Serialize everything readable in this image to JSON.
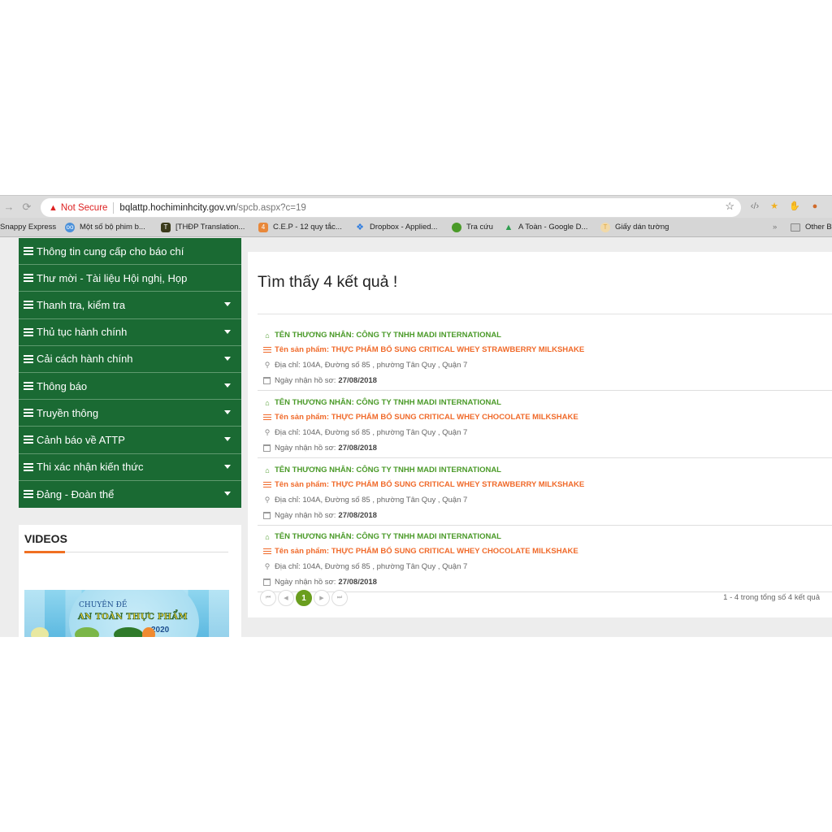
{
  "browser": {
    "nav": {
      "forward_icon": "→",
      "reload_icon": "⟳"
    },
    "security_label": "Not Secure",
    "url_host": "bqlattp.hochiminhcity.gov.vn",
    "url_path": "/spcb.aspx?c=19",
    "bookmarks": [
      {
        "label": "Snappy Express",
        "icon": "none"
      },
      {
        "label": "Một số bộ phim b...",
        "icon": "owl-icon",
        "color": "#4a90d9"
      },
      {
        "label": "[THĐP Translation...",
        "icon": "t-logo-icon",
        "color": "#3a3a1a"
      },
      {
        "label": "C.E.P - 12 quy tắc...",
        "icon": "c-logo-icon",
        "color": "#e8883a"
      },
      {
        "label": "Dropbox - Applied...",
        "icon": "dropbox-icon",
        "color": "#2f7de0"
      },
      {
        "label": "Tra cứu",
        "icon": "green-badge-icon",
        "color": "#4a9a28"
      },
      {
        "label": "A Toàn - Google D...",
        "icon": "google-drive-icon",
        "color": "#2e9d4f"
      },
      {
        "label": "Giấy dán tường",
        "icon": "t-circle-icon",
        "color": "#e0a840"
      }
    ],
    "more_bookmarks": "»",
    "other_bookmarks": "Other B"
  },
  "sidebar": {
    "menu": [
      {
        "label": "Thông tin cung cấp cho báo chí",
        "has_submenu": false
      },
      {
        "label": "Thư mời - Tài liệu Hội nghị, Họp",
        "has_submenu": false
      },
      {
        "label": "Thanh tra, kiểm tra",
        "has_submenu": true
      },
      {
        "label": "Thủ tục hành chính",
        "has_submenu": true
      },
      {
        "label": "Cải cách hành chính",
        "has_submenu": true
      },
      {
        "label": "Thông báo",
        "has_submenu": true
      },
      {
        "label": "Truyền thông",
        "has_submenu": true
      },
      {
        "label": "Cảnh báo về ATTP",
        "has_submenu": true
      },
      {
        "label": "Thi xác nhận kiến thức",
        "has_submenu": true
      },
      {
        "label": "Đảng - Đoàn thể",
        "has_submenu": true
      }
    ],
    "videos": {
      "title": "VIDEOS",
      "thumbnail": {
        "subtitle": "CHUYÊN ĐỀ",
        "title": "AN TOÀN THỰC PHẨM",
        "year": "2020"
      }
    }
  },
  "results": {
    "heading": "Tìm thấy 4 kết quả !",
    "items": [
      {
        "merchant": "TÊN THƯƠNG NHÂN: CÔNG TY TNHH MADI INTERNATIONAL",
        "product_label": "Tên sản phẩm:",
        "product": "THỰC PHẨM BỔ SUNG CRITICAL WHEY STRAWBERRY MILKSHAKE",
        "address": "Địa chỉ: 104A, Đường số 85 , phường Tân Quy , Quận 7",
        "date_label": "Ngày nhận hồ sơ:",
        "date": "27/08/2018"
      },
      {
        "merchant": "TÊN THƯƠNG NHÂN: CÔNG TY TNHH MADI INTERNATIONAL",
        "product_label": "Tên sản phẩm:",
        "product": "THỰC PHẨM BỔ SUNG CRITICAL WHEY CHOCOLATE MILKSHAKE",
        "address": "Địa chỉ: 104A, Đường số 85 , phường Tân Quy , Quận 7",
        "date_label": "Ngày nhận hồ sơ:",
        "date": "27/08/2018"
      },
      {
        "merchant": "TÊN THƯƠNG NHÂN: CÔNG TY TNHH MADI INTERNATIONAL",
        "product_label": "Tên sản phẩm:",
        "product": "THỰC PHẨM BỔ SUNG CRITICAL WHEY STRAWBERRY MILKSHAKE",
        "address": "Địa chỉ: 104A, Đường số 85 , phường Tân Quy , Quận 7",
        "date_label": "Ngày nhận hồ sơ:",
        "date": "27/08/2018"
      },
      {
        "merchant": "TÊN THƯƠNG NHÂN: CÔNG TY TNHH MADI INTERNATIONAL",
        "product_label": "Tên sản phẩm:",
        "product": "THỰC PHẨM BỔ SUNG CRITICAL WHEY CHOCOLATE MILKSHAKE",
        "address": "Địa chỉ: 104A, Đường số 85 , phường Tân Quy , Quận 7",
        "date_label": "Ngày nhận hồ sơ:",
        "date": "27/08/2018"
      }
    ],
    "pager": {
      "first": "⏮",
      "prev": "◀",
      "current": "1",
      "next": "▶",
      "last": "⏭",
      "summary": "1 - 4 trong tổng số 4 kết quả"
    }
  },
  "colors": {
    "menu_bg": "#1a6a33",
    "merchant_green": "#4a9a28",
    "product_orange": "#f06a2a",
    "pager_active": "#6a9e1f",
    "videos_accent": "#f07022"
  }
}
